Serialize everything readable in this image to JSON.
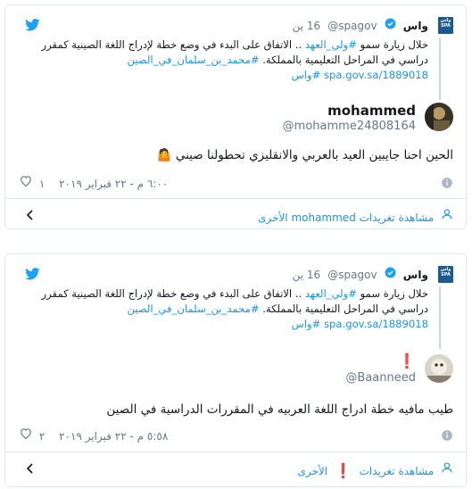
{
  "colors": {
    "link": "#1b95e0",
    "meta": "#657786",
    "border": "#e1e8ed",
    "verified": "#1da1f2",
    "alert": "#d0021b"
  },
  "cards": [
    {
      "context": {
        "source_name": "واس",
        "source_handle": "@spagov",
        "time": "16 ين",
        "text_before": "خلال زيارة سمو ",
        "hashtag1": "#ولي_العهد",
        "text_after": " .. الاتفاق على البدء في وضع خطة لإدراج اللغة الصينية كمقرر دراسي في المراحل التعليمية بالمملكة.",
        "hashtag2": "#محمد_بن_سلمان_في_الصين",
        "url": "spa.gov.sa/1889018",
        "hashtag3": "#واس"
      },
      "author": {
        "name": "mohammed",
        "handle": "@mohamme24808164"
      },
      "tweet_text": "الحين احنا جايبين العيد بالعربي والانقليزي تحطولنا صيني",
      "emoji": "🤷",
      "like_count": "١",
      "timestamp": "٦:٠٠ م - ٢٢ فبراير ٢٠١٩",
      "footer_text": "مشاهدة تغريدات mohammed الأخرى"
    },
    {
      "context": {
        "source_name": "واس",
        "source_handle": "@spagov",
        "time": "16 ين",
        "text_before": "خلال زيارة سمو ",
        "hashtag1": "#ولي_العهد",
        "text_after": " .. الاتفاق على البدء في وضع خطة لإدراج اللغة الصينية كمقرر دراسي في المراحل التعليمية بالمملكة.",
        "hashtag2": "#محمد_بن_سلمان_في_الصين",
        "url": "spa.gov.sa/1889018",
        "hashtag3": "#واس"
      },
      "author": {
        "name": "",
        "handle": "@Baanneed",
        "badge": "❗"
      },
      "tweet_text": "طيب مافيه خطة ادراج اللغة العربيه في المقررات الدراسية في الصين",
      "like_count": "٢",
      "timestamp": "٥:٥٨ م - ٢٢ فبراير ٢٠١٩",
      "footer_text": "مشاهدة تغريدات",
      "footer_badge": "❗",
      "footer_text2": "الأخرى"
    }
  ]
}
